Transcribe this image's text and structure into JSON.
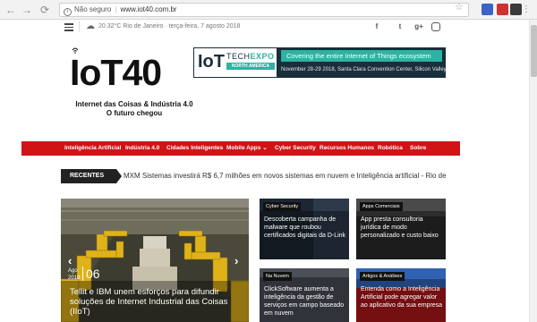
{
  "browser": {
    "back": "←",
    "forward": "→",
    "reload": "⟳",
    "info_icon": "i",
    "security_label": "Não seguro",
    "url": "www.iot40.com.br",
    "star": "☆",
    "menu": "⋮"
  },
  "topbar": {
    "weather_icon": "cloud-icon",
    "weather_text": "20.32°C Rio de Janeiro · terça-feira, 7 agosto 2018",
    "social": [
      "f",
      "t",
      "g+",
      "ig"
    ]
  },
  "header": {
    "logo": "IoT40",
    "tagline_1": "Internet das Coisas & Indústria 4.0",
    "tagline_2": "O futuro chegou"
  },
  "banner": {
    "iot": "IoT",
    "tech": "TECH",
    "expo": "EXPO",
    "region": "NORTH AMERICA 2018",
    "ribbon": "Covering the entire Internet of Things ecosystem",
    "date": "November 28-29 2018, Santa Clara Convention Center, Silicon Valley",
    "accent": "#2bb3a3",
    "background": "#1a2e3b"
  },
  "nav": {
    "color": "#d11316",
    "items": [
      "Inteligência Artificial",
      "Indústria 4.0",
      "Cidades Inteligentes",
      "Mobile Apps",
      "Cyber Security",
      "Recursos Humanos",
      "Robótica",
      "Sobre"
    ]
  },
  "ticker": {
    "label": "RECENTES",
    "text": "MXM Sistemas investirá R$ 6,7 milhões em novos sistemas em nuvem e Inteligência artificial - Rio de"
  },
  "feature": {
    "month": "Ago",
    "year": "2018",
    "day": "06",
    "title": "Tellit e IBM unem esforços para difundir soluções de Internet Industrial das Coisas (IIoT)",
    "prev": "‹",
    "next": "›"
  },
  "cards": [
    {
      "tag": "Cyber Security",
      "text": "Descoberta campanha de malware que roubou certificados digitais da D-Link"
    },
    {
      "tag": "Apps Comerciais",
      "text": "App presta consultoria jurídica de modo personalizado e custo baixo"
    },
    {
      "tag": "Na Nuvem",
      "text": "ClickSoftware aumenta a inteligência da gestão de serviços em campo baseado em nuvem"
    },
    {
      "tag": "Artigos & Análises",
      "text": "Entenda como a Inteligência Artificial pode agregar valor ao aplicativo da sua empresa"
    }
  ]
}
